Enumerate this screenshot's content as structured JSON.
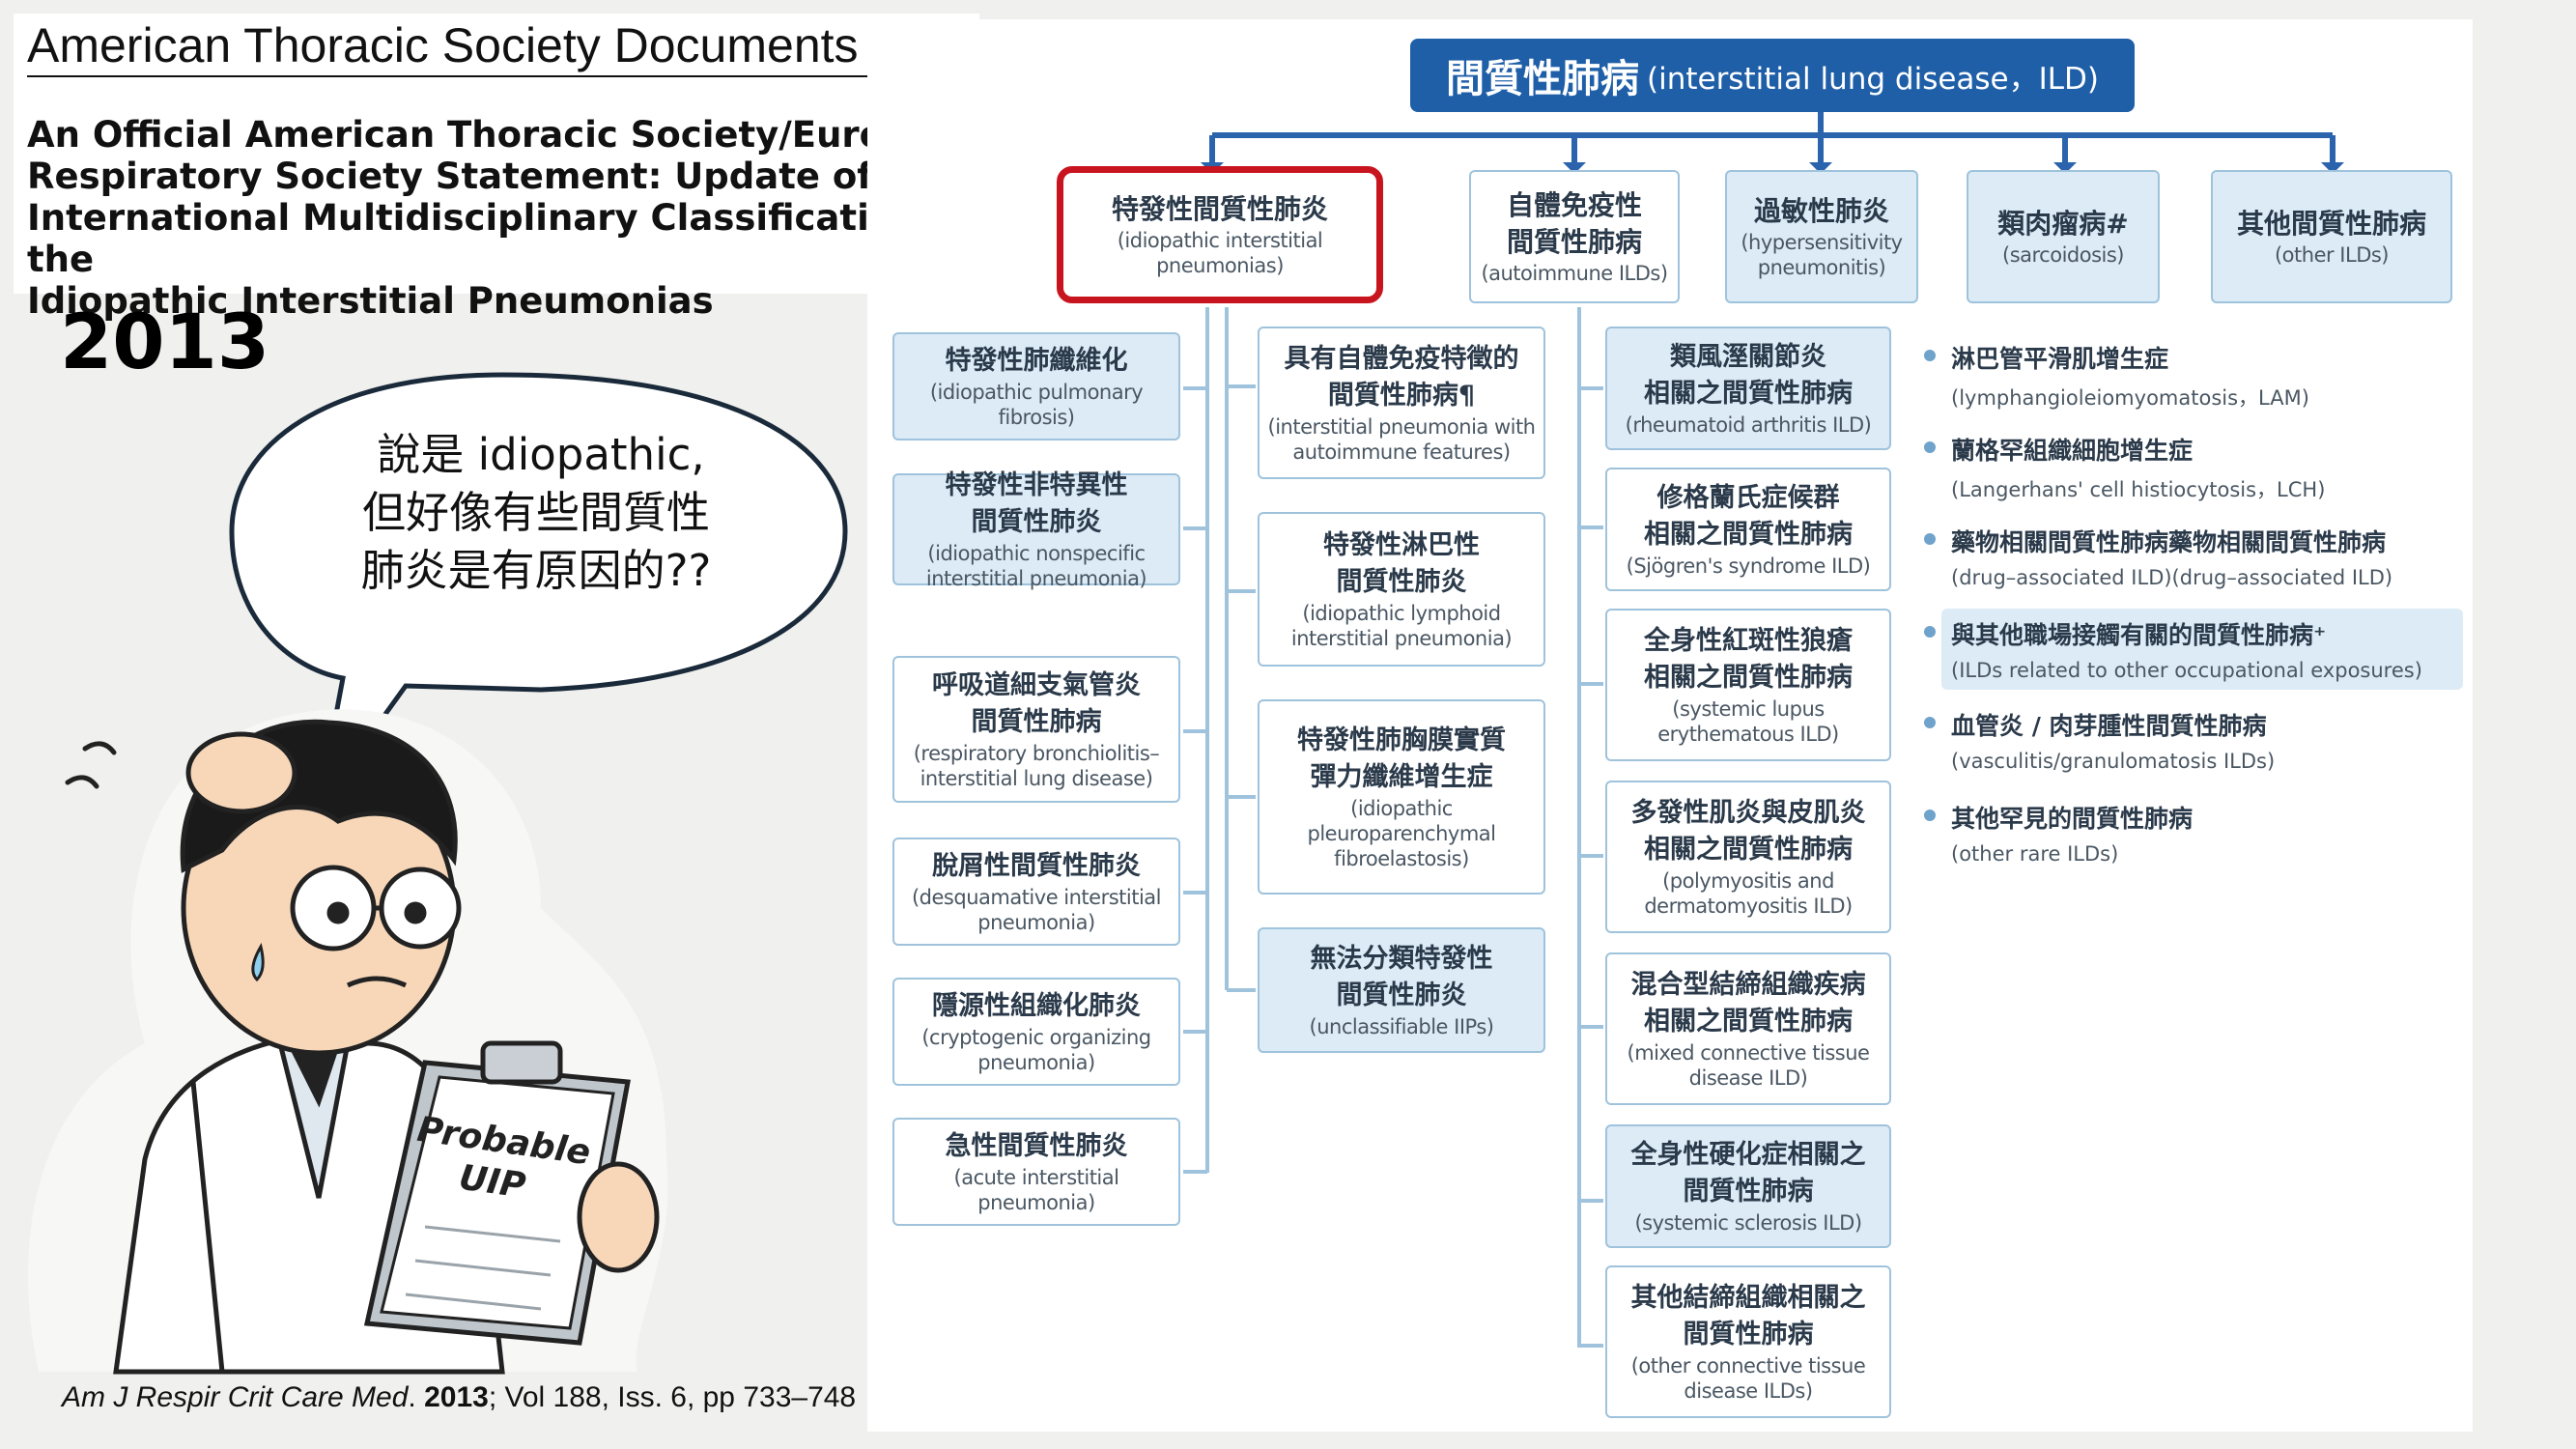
{
  "header": {
    "ats_title": "American Thoracic Society Documents",
    "paper_title_lines": [
      "An Official American Thoracic Society/European",
      "Respiratory Society Statement: Update of the",
      "International Multidisciplinary Classification of the",
      "Idiopathic Interstitial Pneumonias"
    ],
    "year": "2013"
  },
  "bubble": {
    "lines": [
      "說是 idiopathic,",
      "但好像有些間質性",
      "肺炎是有原因的??"
    ]
  },
  "clipboard": {
    "line1": "Probable",
    "line2": "UIP"
  },
  "citation": {
    "journal": "Am J Respir Crit Care Med",
    "year": "2013",
    "rest": "; Vol 188, Iss. 6, pp 733–748"
  },
  "root": {
    "zh": "間質性肺病",
    "en": "(interstitial lung disease，ILD)"
  },
  "categories": [
    {
      "zh": [
        "特發性間質性肺炎"
      ],
      "en": [
        "(idiopathic interstitial pneumonias)"
      ]
    },
    {
      "zh": [
        "自體免疫性",
        "間質性肺病"
      ],
      "en": [
        "(autoimmune ILDs)"
      ]
    },
    {
      "zh": [
        "過敏性肺炎"
      ],
      "en": [
        "(hypersensitivity",
        "pneumonitis)"
      ]
    },
    {
      "zh": [
        "類肉瘤病#"
      ],
      "en": [
        "(sarcoidosis)"
      ]
    },
    {
      "zh": [
        "其他間質性肺病"
      ],
      "en": [
        "(other ILDs)"
      ]
    }
  ],
  "iip_col1": [
    {
      "zh": [
        "特發性肺纖維化"
      ],
      "en": [
        "(idiopathic pulmonary",
        "fibrosis)"
      ]
    },
    {
      "zh": [
        "特發性非特異性",
        "間質性肺炎"
      ],
      "en": [
        "(idiopathic nonspecific",
        "interstitial pneumonia)"
      ]
    },
    {
      "zh": [
        "呼吸道細支氣管炎",
        "間質性肺病"
      ],
      "en": [
        "(respiratory bronchiolitis–",
        "interstitial lung disease)"
      ]
    },
    {
      "zh": [
        "脫屑性間質性肺炎"
      ],
      "en": [
        "(desquamative interstitial",
        "pneumonia)"
      ]
    },
    {
      "zh": [
        "隱源性組織化肺炎"
      ],
      "en": [
        "(cryptogenic organizing",
        "pneumonia)"
      ]
    },
    {
      "zh": [
        "急性間質性肺炎"
      ],
      "en": [
        "(acute interstitial",
        "pneumonia)"
      ]
    }
  ],
  "iip_col2": [
    {
      "zh": [
        "具有自體免疫特徵的",
        "間質性肺病¶"
      ],
      "en": [
        "(interstitial pneumonia with",
        "autoimmune features)"
      ]
    },
    {
      "zh": [
        "特發性淋巴性",
        "間質性肺炎"
      ],
      "en": [
        "(idiopathic lymphoid",
        "interstitial pneumonia)"
      ]
    },
    {
      "zh": [
        "特發性肺胸膜實質",
        "彈力纖維增生症"
      ],
      "en": [
        "(idiopathic",
        "pleuroparenchymal",
        "fibroelastosis)"
      ]
    },
    {
      "zh": [
        "無法分類特發性",
        "間質性肺炎"
      ],
      "en": [
        "(unclassifiable IIPs)"
      ]
    }
  ],
  "autoimmune_list": [
    {
      "zh": [
        "類風溼關節炎",
        "相關之間質性肺病"
      ],
      "en": [
        "(rheumatoid arthritis ILD)"
      ]
    },
    {
      "zh": [
        "修格蘭氏症候群",
        "相關之間質性肺病"
      ],
      "en": [
        "(Sjögren's syndrome ILD)"
      ]
    },
    {
      "zh": [
        "全身性紅斑性狼瘡",
        "相關之間質性肺病"
      ],
      "en": [
        "(systemic lupus",
        "erythematous ILD)"
      ]
    },
    {
      "zh": [
        "多發性肌炎與皮肌炎",
        "相關之間質性肺病"
      ],
      "en": [
        "(polymyositis and",
        "dermatomyositis ILD)"
      ]
    },
    {
      "zh": [
        "混合型結締組織疾病",
        "相關之間質性肺病"
      ],
      "en": [
        "(mixed connective tissue",
        "disease ILD)"
      ]
    },
    {
      "zh": [
        "全身性硬化症相關之",
        "間質性肺病"
      ],
      "en": [
        "(systemic sclerosis ILD)"
      ]
    },
    {
      "zh": [
        "其他結締組織相關之",
        "間質性肺病"
      ],
      "en": [
        "(other connective tissue",
        "disease ILDs)"
      ]
    }
  ],
  "other_ilds": [
    {
      "zh": "淋巴管平滑肌增生症",
      "en": "(lymphangioleiomyomatosis，LAM)"
    },
    {
      "zh": "蘭格罕組織細胞增生症",
      "en": "(Langerhans' cell histiocytosis，LCH)"
    },
    {
      "zh": "藥物相關間質性肺病藥物相關間質性肺病",
      "en": "(drug–associated ILD)(drug–associated ILD)"
    },
    {
      "zh": "與其他職場接觸有關的間質性肺病⁺",
      "en": "(ILDs related to other occupational exposures)"
    },
    {
      "zh": "血管炎 / 肉芽腫性間質性肺病",
      "en": "(vasculitis/granulomatosis ILDs)"
    },
    {
      "zh": "其他罕見的間質性肺病",
      "en": "(other rare ILDs)"
    }
  ],
  "colors": {
    "root": "#1f5fa8",
    "connector": "#2b63ad",
    "box_fill": "#dcebf6",
    "box_border": "#9fc3dc",
    "highlight": "#c8141e"
  }
}
